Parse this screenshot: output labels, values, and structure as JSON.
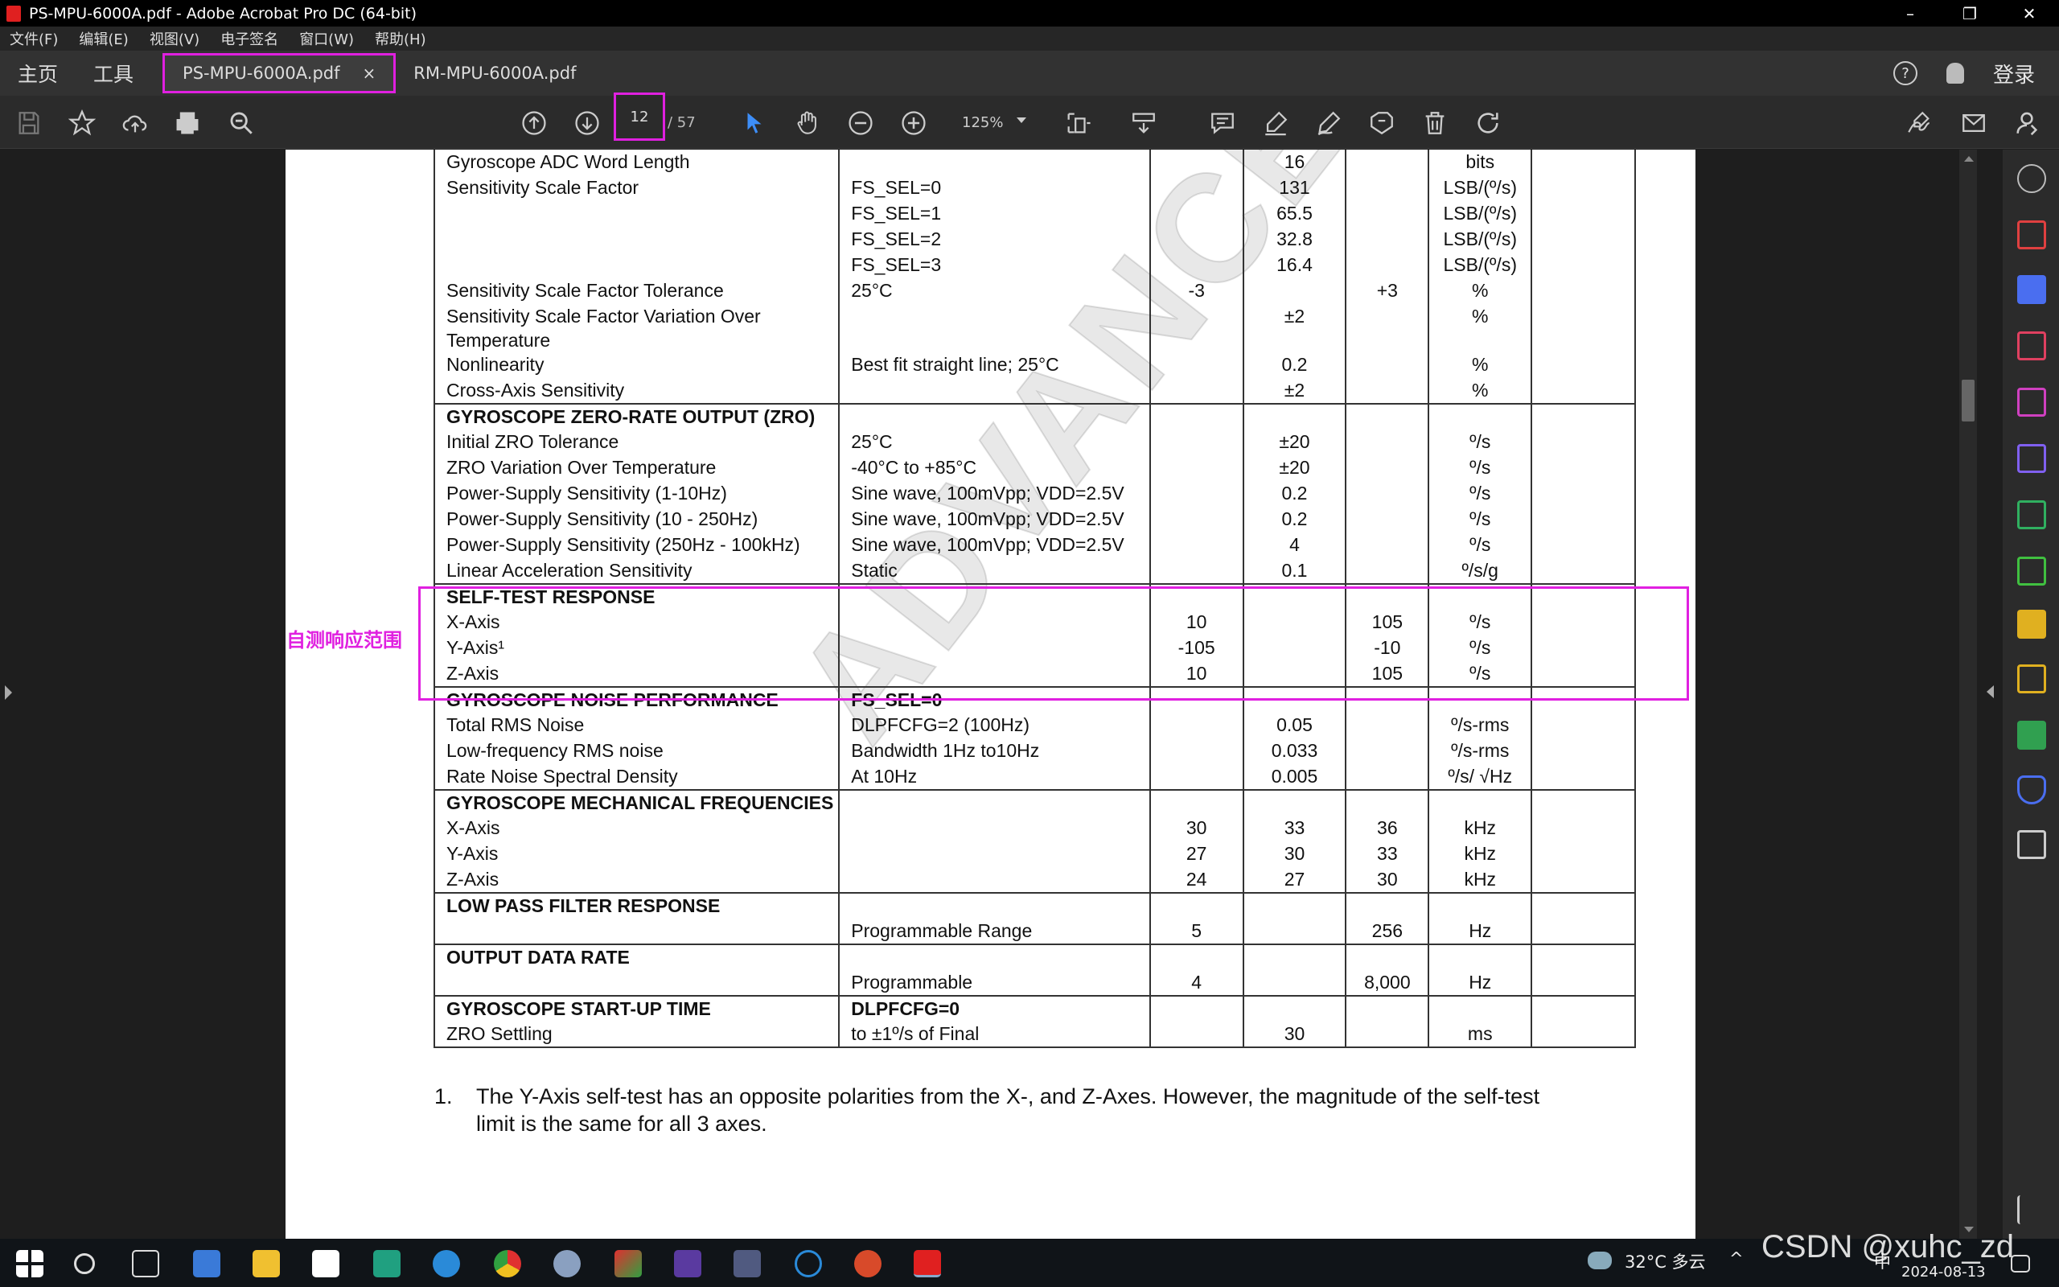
{
  "window": {
    "title": "PS-MPU-6000A.pdf - Adobe Acrobat Pro DC (64-bit)",
    "minimize": "–",
    "maximize": "❐",
    "close": "✕"
  },
  "menu": [
    "文件(F)",
    "编辑(E)",
    "视图(V)",
    "电子签名",
    "窗口(W)",
    "帮助(H)"
  ],
  "tabs": {
    "home": "主页",
    "tools": "工具",
    "doc1": "PS-MPU-6000A.pdf",
    "doc1_close": "×",
    "doc2": "RM-MPU-6000A.pdf",
    "help": "?",
    "login": "登录"
  },
  "toolbar": {
    "page_current": "12",
    "page_total": "/ 57",
    "zoom": "125%"
  },
  "table": {
    "rows": [
      {
        "c": [
          "Gyroscope ADC Word Length",
          "",
          "",
          "16",
          "",
          "bits"
        ]
      },
      {
        "c": [
          "Sensitivity Scale Factor",
          "FS_SEL=0",
          "",
          "131",
          "",
          "LSB/(º/s)"
        ]
      },
      {
        "c": [
          "",
          "FS_SEL=1",
          "",
          "65.5",
          "",
          "LSB/(º/s)"
        ]
      },
      {
        "c": [
          "",
          "FS_SEL=2",
          "",
          "32.8",
          "",
          "LSB/(º/s)"
        ]
      },
      {
        "c": [
          "",
          "FS_SEL=3",
          "",
          "16.4",
          "",
          "LSB/(º/s)"
        ]
      },
      {
        "c": [
          "Sensitivity Scale Factor Tolerance",
          "25°C",
          "-3",
          "",
          "+3",
          "%"
        ]
      },
      {
        "c": [
          "Sensitivity Scale Factor Variation Over Temperature",
          "",
          "",
          "±2",
          "",
          "%"
        ]
      },
      {
        "c": [
          "Nonlinearity",
          "Best fit straight line; 25°C",
          "",
          "0.2",
          "",
          "%"
        ]
      },
      {
        "c": [
          "Cross-Axis Sensitivity",
          "",
          "",
          "±2",
          "",
          "%"
        ]
      },
      {
        "h": true,
        "c": [
          "GYROSCOPE ZERO-RATE OUTPUT (ZRO)",
          "",
          "",
          "",
          "",
          ""
        ]
      },
      {
        "c": [
          "Initial ZRO Tolerance",
          "25°C",
          "",
          "±20",
          "",
          "º/s"
        ]
      },
      {
        "c": [
          "ZRO Variation Over Temperature",
          "-40°C to +85°C",
          "",
          "±20",
          "",
          "º/s"
        ]
      },
      {
        "c": [
          "Power-Supply Sensitivity (1-10Hz)",
          "Sine wave, 100mVpp; VDD=2.5V",
          "",
          "0.2",
          "",
          "º/s"
        ]
      },
      {
        "c": [
          "Power-Supply Sensitivity (10 - 250Hz)",
          "Sine wave, 100mVpp; VDD=2.5V",
          "",
          "0.2",
          "",
          "º/s"
        ]
      },
      {
        "c": [
          "Power-Supply Sensitivity (250Hz - 100kHz)",
          "Sine wave, 100mVpp; VDD=2.5V",
          "",
          "4",
          "",
          "º/s"
        ]
      },
      {
        "c": [
          "Linear Acceleration Sensitivity",
          "Static",
          "",
          "0.1",
          "",
          "º/s/g"
        ]
      },
      {
        "h": true,
        "c": [
          "SELF-TEST RESPONSE",
          "",
          "",
          "",
          "",
          ""
        ]
      },
      {
        "c": [
          "X-Axis",
          "",
          "10",
          "",
          "105",
          "º/s"
        ]
      },
      {
        "c": [
          "Y-Axis¹",
          "",
          "-105",
          "",
          "-10",
          "º/s"
        ]
      },
      {
        "c": [
          "Z-Axis",
          "",
          "10",
          "",
          "105",
          "º/s"
        ]
      },
      {
        "h": true,
        "c": [
          "GYROSCOPE NOISE PERFORMANCE",
          "FS_SEL=0",
          "",
          "",
          "",
          ""
        ]
      },
      {
        "c": [
          "Total RMS Noise",
          "DLPFCFG=2 (100Hz)",
          "",
          "0.05",
          "",
          "º/s-rms"
        ]
      },
      {
        "c": [
          "Low-frequency RMS noise",
          "Bandwidth 1Hz to10Hz",
          "",
          "0.033",
          "",
          "º/s-rms"
        ]
      },
      {
        "c": [
          "Rate Noise Spectral Density",
          "At 10Hz",
          "",
          "0.005",
          "",
          "º/s/ √Hz"
        ]
      },
      {
        "h": true,
        "c": [
          "GYROSCOPE MECHANICAL FREQUENCIES",
          "",
          "",
          "",
          "",
          ""
        ]
      },
      {
        "c": [
          "X-Axis",
          "",
          "30",
          "33",
          "36",
          "kHz"
        ]
      },
      {
        "c": [
          "Y-Axis",
          "",
          "27",
          "30",
          "33",
          "kHz"
        ]
      },
      {
        "c": [
          "Z-Axis",
          "",
          "24",
          "27",
          "30",
          "kHz"
        ]
      },
      {
        "h": true,
        "c": [
          "LOW PASS FILTER RESPONSE",
          "",
          "",
          "",
          "",
          ""
        ]
      },
      {
        "c": [
          "",
          "Programmable Range",
          "5",
          "",
          "256",
          "Hz"
        ]
      },
      {
        "h": true,
        "c": [
          "OUTPUT DATA RATE",
          "",
          "",
          "",
          "",
          ""
        ]
      },
      {
        "c": [
          "",
          "Programmable",
          "4",
          "",
          "8,000",
          "Hz"
        ]
      },
      {
        "h": true,
        "c": [
          "GYROSCOPE START-UP TIME",
          "DLPFCFG=0",
          "",
          "",
          "",
          ""
        ]
      },
      {
        "c": [
          "ZRO Settling",
          "to ±1º/s of Final",
          "",
          "30",
          "",
          "ms"
        ]
      }
    ]
  },
  "footnote": {
    "num": "1.",
    "text": "The Y-Axis self-test has an opposite polarities from the X-, and Z-Axes. However, the magnitude of the self-test limit is the same for all 3 axes."
  },
  "annotation": "自测响应范围",
  "watermark": "ADVANCE INFORMATION",
  "taskbar": {
    "weather": "32°C 多云",
    "lang": "中",
    "date": "2024-08-13"
  },
  "overlay": "CSDN @xuhc_zd",
  "colors": {
    "highlight": "#e020e0",
    "acrobat_red": "#e02020"
  }
}
